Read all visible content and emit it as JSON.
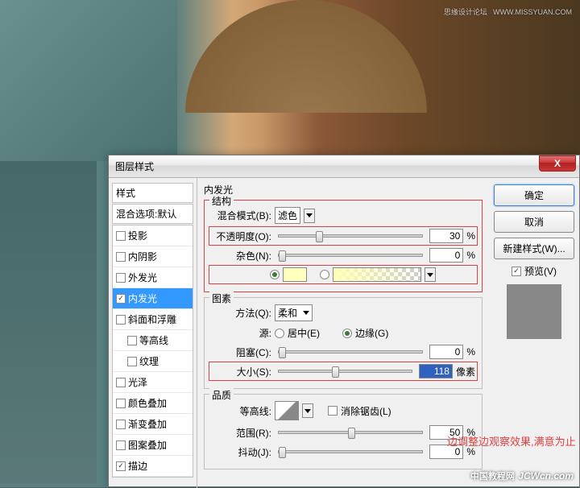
{
  "watermark_top": {
    "text": "思缘设计论坛",
    "url": "WWW.MISSYUAN.COM"
  },
  "watermark_bottom": {
    "cn": "中国教程网",
    "en": "JCWcn.com"
  },
  "dialog": {
    "title": "图层样式",
    "close": "X",
    "styles_header": "样式",
    "blend_options": "混合选项:默认",
    "style_items": [
      {
        "label": "投影",
        "checked": false
      },
      {
        "label": "内阴影",
        "checked": false
      },
      {
        "label": "外发光",
        "checked": false
      },
      {
        "label": "内发光",
        "checked": true,
        "selected": true
      },
      {
        "label": "斜面和浮雕",
        "checked": false
      },
      {
        "label": "等高线",
        "checked": false,
        "indent": true
      },
      {
        "label": "纹理",
        "checked": false,
        "indent": true
      },
      {
        "label": "光泽",
        "checked": false
      },
      {
        "label": "颜色叠加",
        "checked": false
      },
      {
        "label": "渐变叠加",
        "checked": false
      },
      {
        "label": "图案叠加",
        "checked": false
      },
      {
        "label": "描边",
        "checked": true
      }
    ],
    "panel_title": "内发光",
    "group_structure": "结构",
    "blend_mode_label": "混合模式(B):",
    "blend_mode_value": "滤色",
    "opacity_label": "不透明度(O):",
    "opacity_value": "30",
    "noise_label": "杂色(N):",
    "noise_value": "0",
    "percent": "%",
    "swatch_color": "#ffffbe",
    "group_elements": "图素",
    "method_label": "方法(Q):",
    "method_value": "柔和",
    "source_label": "源:",
    "source_center": "居中(E)",
    "source_edge": "边缘(G)",
    "choke_label": "阻塞(C):",
    "choke_value": "0",
    "size_label": "大小(S):",
    "size_value": "118",
    "size_unit": "像素",
    "group_quality": "品质",
    "contour_label": "等高线:",
    "antialias_label": "消除锯齿(L)",
    "range_label": "范围(R):",
    "range_value": "50",
    "jitter_label": "抖动(J):",
    "jitter_value": "0",
    "buttons": {
      "ok": "确定",
      "cancel": "取消",
      "new_style": "新建样式(W)...",
      "preview": "预览(V)"
    },
    "annotation": "边调整边观察效果,满意为止"
  }
}
